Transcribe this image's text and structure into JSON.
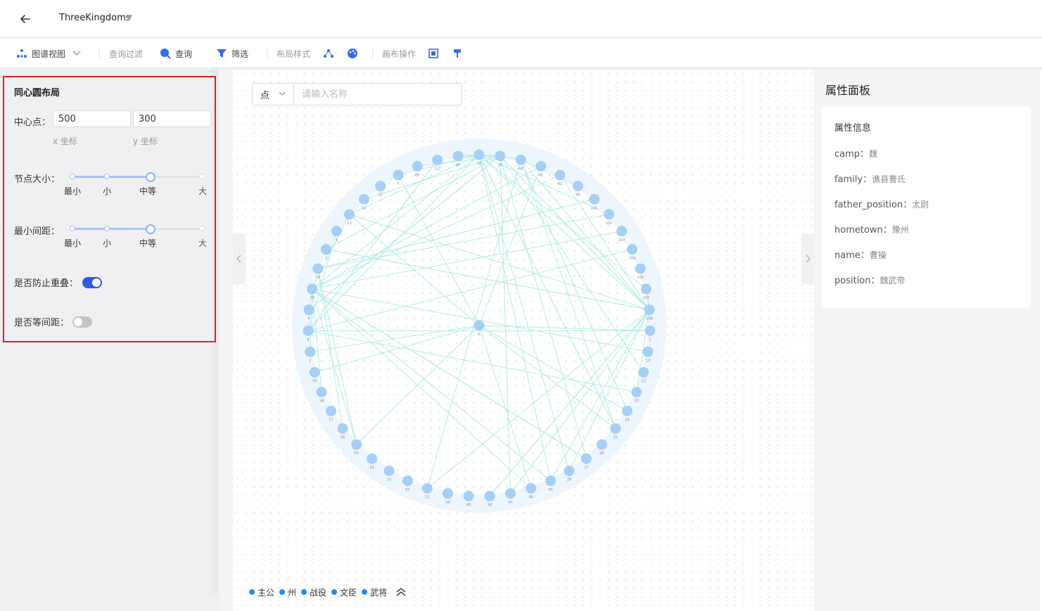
{
  "app": {
    "title": "ThreeKingdoms"
  },
  "toolbar": {
    "graph_view": "图谱视图",
    "query_filter": "查询过滤",
    "query": "查询",
    "filter": "筛选",
    "layout_style": "布局样式",
    "canvas_ops": "画布操作"
  },
  "layout_panel": {
    "title": "同心圆布局",
    "center_label": "中心点：",
    "center_x": "500",
    "center_y": "300",
    "x_hint": "x 坐标",
    "y_hint": "y 坐标",
    "node_size_label": "节点大小：",
    "node_size_value": 0.6,
    "min_gap_label": "最小间距：",
    "min_gap_value": 0.6,
    "marks": [
      "最小",
      "小",
      "中等",
      "大"
    ],
    "prevent_overlap_label": "是否防止重叠：",
    "prevent_overlap": true,
    "equidistant_label": "是否等间距：",
    "equidistant": false
  },
  "search": {
    "type": "点",
    "placeholder": "请输入名称"
  },
  "graph": {
    "node_color": "#a6cff6",
    "edge_color": "#b5ece3",
    "center_node": "0",
    "ring_nodes": [
      "16",
      "15",
      "88",
      "81",
      "62",
      "98",
      "100",
      "101",
      "103",
      "104",
      "105",
      "107",
      "108",
      "1",
      "10",
      "22",
      "23",
      "24",
      "25",
      "26",
      "27",
      "28",
      "45",
      "46",
      "47",
      "48",
      "49",
      "50",
      "51",
      "52",
      "53",
      "54",
      "55",
      "56",
      "57",
      "58",
      "59",
      "2",
      "8",
      "9",
      "29",
      "71",
      "3",
      "5",
      "13",
      "14",
      "15",
      "7",
      "86",
      "111",
      "95"
    ]
  },
  "legend": {
    "items": [
      "主公",
      "州",
      "战役",
      "文臣",
      "武将"
    ],
    "color": "#1d8ef0"
  },
  "properties": {
    "panel_title": "属性面板",
    "section_title": "属性信息",
    "rows": [
      {
        "key": "camp：",
        "value": "魏"
      },
      {
        "key": "family：",
        "value": "谯县曹氏"
      },
      {
        "key": "father_position：",
        "value": "太尉"
      },
      {
        "key": "hometown：",
        "value": "豫州"
      },
      {
        "key": "name：",
        "value": "曹操"
      },
      {
        "key": "position：",
        "value": "魏武帝"
      }
    ]
  }
}
